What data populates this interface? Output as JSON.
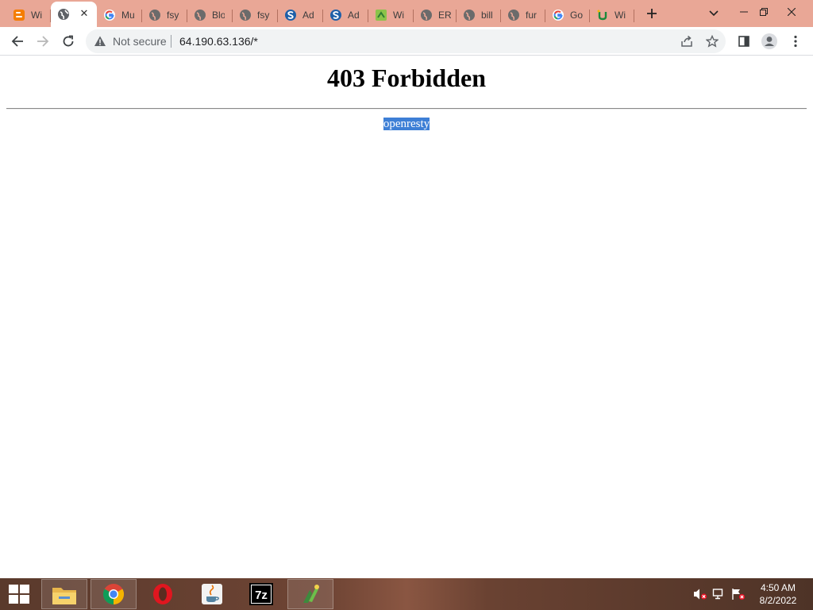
{
  "browser": {
    "tabs": [
      {
        "label": "Wi",
        "icon": "blogger-icon"
      },
      {
        "label": "",
        "icon": "globe-icon",
        "active": true
      },
      {
        "label": "Mu",
        "icon": "google-icon"
      },
      {
        "label": "fsy",
        "icon": "globe-icon"
      },
      {
        "label": "Blo",
        "icon": "globe-icon"
      },
      {
        "label": "fsy",
        "icon": "globe-icon"
      },
      {
        "label": "Ad",
        "icon": "s-logo-icon"
      },
      {
        "label": "Ad",
        "icon": "s-logo-icon"
      },
      {
        "label": "Wi",
        "icon": "green-square-icon"
      },
      {
        "label": "ER",
        "icon": "globe-icon"
      },
      {
        "label": "bill",
        "icon": "globe-icon"
      },
      {
        "label": "fur",
        "icon": "globe-icon"
      },
      {
        "label": "Go",
        "icon": "google-icon"
      },
      {
        "label": "Wi",
        "icon": "u-logo-icon"
      }
    ],
    "address": {
      "security_label": "Not secure",
      "url": "64.190.63.136/*"
    }
  },
  "page": {
    "heading": "403 Forbidden",
    "server": "openresty"
  },
  "taskbar": {
    "apps": [
      "file-explorer-icon",
      "chrome-icon",
      "opera-icon",
      "java-icon",
      "7zip-icon",
      "app-icon"
    ],
    "time": "4:50 AM",
    "date": "8/2/2022"
  },
  "colors": {
    "tabstrip": "#e9a796",
    "selection": "#3d7fd6"
  }
}
